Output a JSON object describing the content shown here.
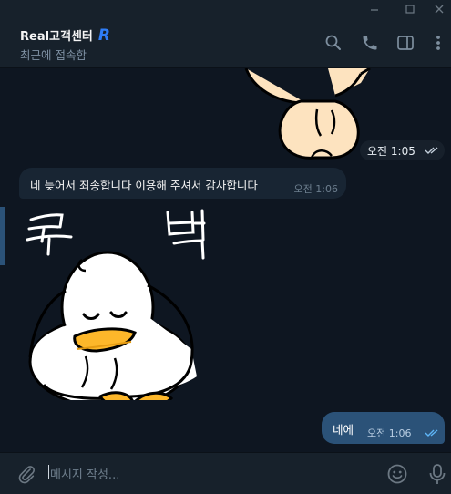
{
  "window": {
    "minimize_icon": "minimize-icon",
    "maximize_icon": "maximize-icon",
    "close_icon": "close-icon"
  },
  "header": {
    "title": "Real고객센터",
    "title_badge": "R",
    "status": "최근에 접속함",
    "icons": [
      "search-icon",
      "phone-icon",
      "sidebar-toggle-icon",
      "more-vertical-icon"
    ]
  },
  "messages": [
    {
      "type": "sticker",
      "direction": "outgoing",
      "name": "bear-sticker",
      "time": "오전 1:05",
      "status": "read"
    },
    {
      "type": "text",
      "direction": "incoming",
      "text": "네 늦어서 죄송합니다 이용해 주셔서 감사합니다",
      "time": "오전 1:06"
    },
    {
      "type": "sticker",
      "direction": "incoming",
      "name": "bowing-duck-sticker",
      "caption": "꾸 벅"
    },
    {
      "type": "text",
      "direction": "outgoing",
      "text": "네에",
      "time": "오전 1:06",
      "status": "read"
    }
  ],
  "composer": {
    "placeholder": "메시지 작성...",
    "icons": [
      "attach-icon",
      "emoji-icon",
      "microphone-icon"
    ]
  },
  "colors": {
    "background": "#0e1621",
    "panel": "#17212b",
    "incoming_bubble": "#182533",
    "outgoing_bubble": "#2b5278",
    "accent": "#5eb5f7"
  }
}
